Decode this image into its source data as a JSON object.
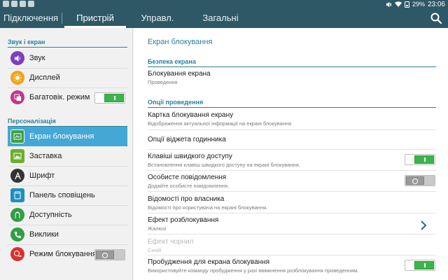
{
  "status": {
    "battery": "29%",
    "time": "23:06"
  },
  "tabs": [
    {
      "label": "Підключення",
      "active": false
    },
    {
      "label": "Пристрій",
      "active": true
    },
    {
      "label": "Управл.",
      "active": false
    },
    {
      "label": "Загальні",
      "active": false
    }
  ],
  "sidebar": {
    "sections": [
      {
        "title": "Звук і екран"
      },
      {
        "title": "Персоналізація"
      }
    ],
    "items": [
      {
        "label": "Звук",
        "icon": "speaker-icon",
        "color": "#7b3fc0"
      },
      {
        "label": "Дисплей",
        "icon": "sun-icon",
        "color": "#f3a21b"
      },
      {
        "label": "Багатовік. режим",
        "icon": "multiwindow-icon",
        "color": "#c2388a",
        "toggle": "on"
      },
      {
        "label": "Екран блокування",
        "icon": "lockscreen-icon",
        "color": "#3aa04a",
        "selected": true
      },
      {
        "label": "Заставка",
        "icon": "wallpaper-icon",
        "color": "#6fae2c"
      },
      {
        "label": "Шрифт",
        "icon": "font-icon",
        "color": "#333333"
      },
      {
        "label": "Панель сповіщень",
        "icon": "notification-panel-icon",
        "color": "#1d8fc0"
      },
      {
        "label": "Доступність",
        "icon": "accessibility-icon",
        "color": "#2f9e45"
      },
      {
        "label": "Виклики",
        "icon": "phone-icon",
        "color": "#2f9e45"
      },
      {
        "label": "Режим блокування",
        "icon": "block-mode-icon",
        "color": "#d9322e",
        "toggle": "off"
      }
    ]
  },
  "main": {
    "title": "Екран блокування",
    "sections": [
      {
        "title": "Безпека екрана"
      },
      {
        "title": "Опції проведення"
      }
    ],
    "rows": [
      {
        "title": "Блокування екрана",
        "subtitle": "Проведення"
      },
      {
        "title": "Картка блокування екрану",
        "subtitle": "Відображення актуальної інформації на екрані блокування"
      },
      {
        "title": "Опції віджета годинника",
        "subtitle": ""
      },
      {
        "title": "Клавіші швидкого доступу",
        "subtitle": "Встановлення клавіш швидкого доступу на екрані блокування.",
        "toggle": "on"
      },
      {
        "title": "Особисте повідомлення",
        "subtitle": "Додайте особисте повідомлення.",
        "toggle": "off"
      },
      {
        "title": "Відомості про власника",
        "subtitle": "Відомості про користувача на екрані блокування."
      },
      {
        "title": "Ефект розблокування",
        "subtitle": "Жалюзі",
        "chevron": true
      },
      {
        "title": "Ефект чорнил",
        "subtitle": "Синій",
        "disabled": true
      },
      {
        "title": "Пробудження для екрана блокування",
        "subtitle": "Використовуйте команду пробудження у разі ввімкнення розблокування проведенням.",
        "toggle": "on"
      }
    ]
  }
}
